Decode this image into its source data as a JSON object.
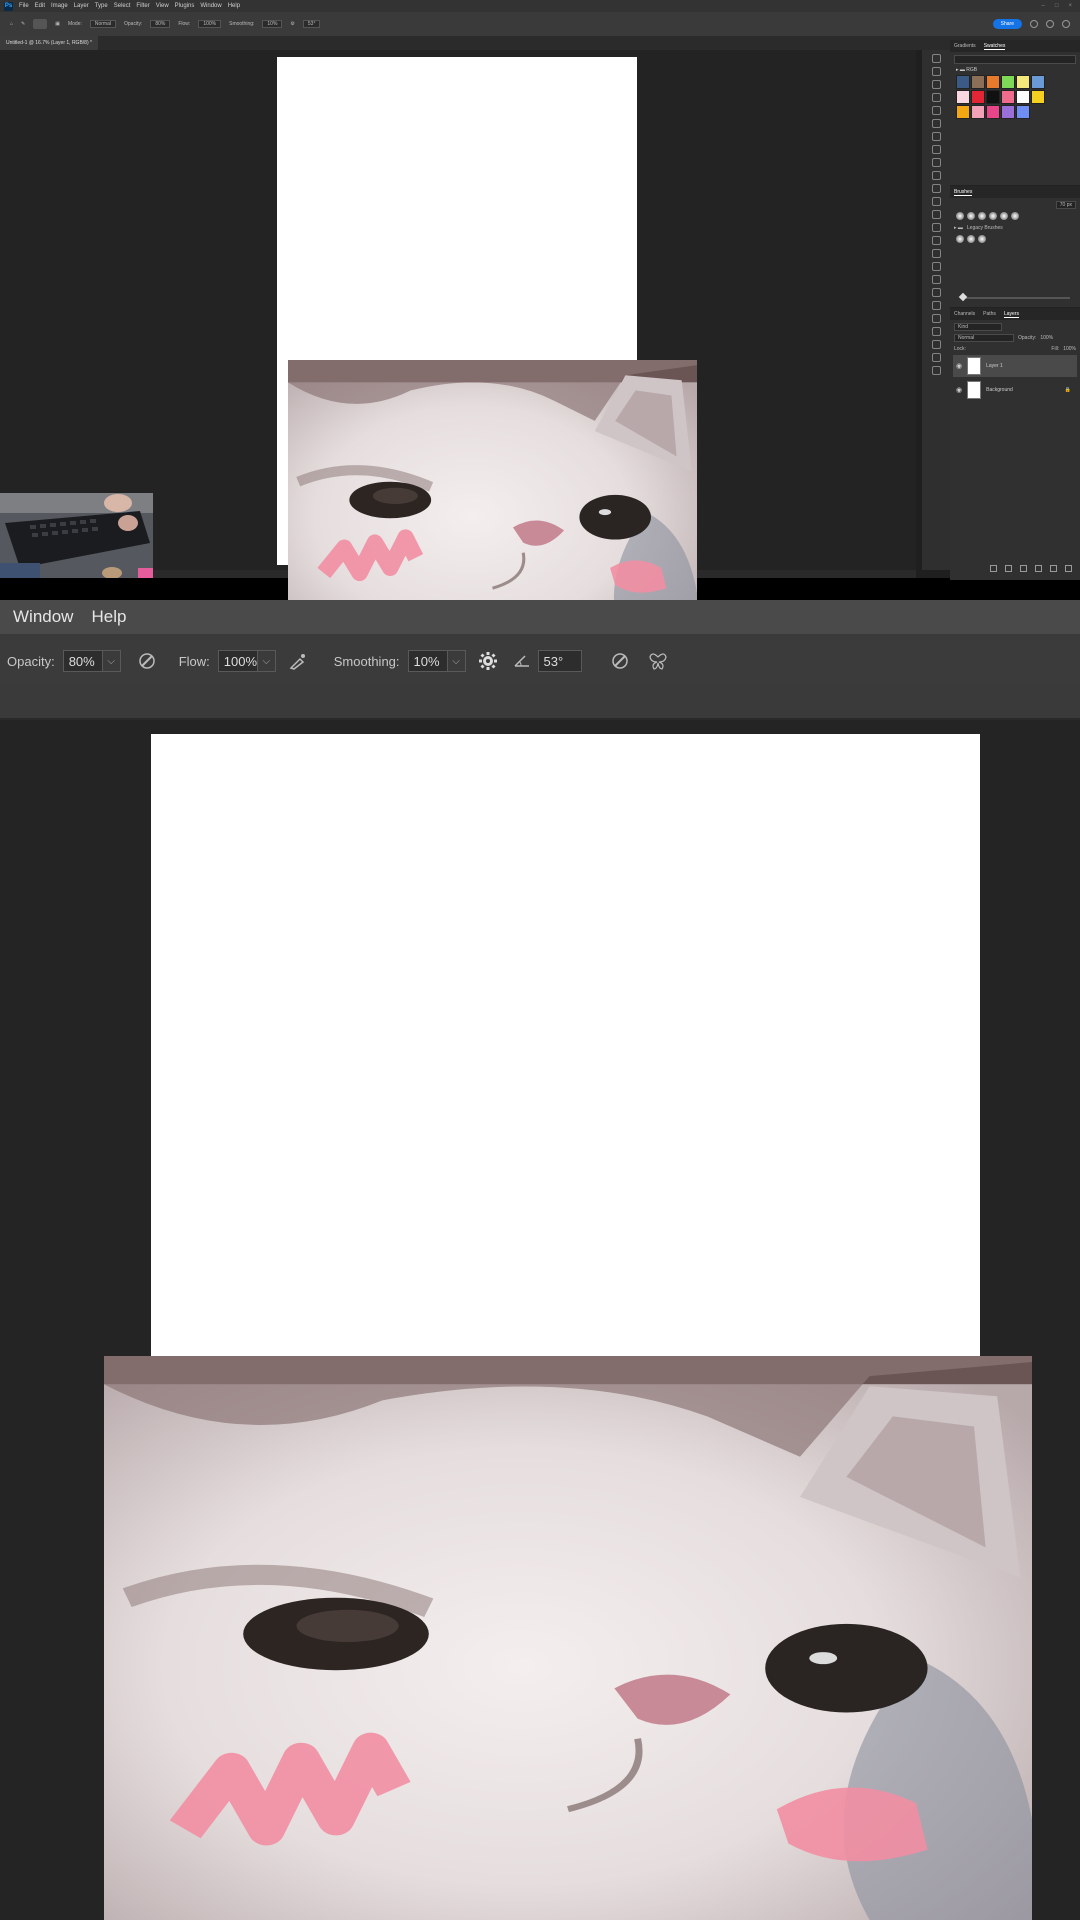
{
  "app": {
    "logo": "Ps",
    "document_tab": "Untitled-1 @ 16.7% (Layer 1, RGB/8) *"
  },
  "menu": {
    "items": [
      "File",
      "Edit",
      "Image",
      "Layer",
      "Type",
      "Select",
      "Filter",
      "View",
      "Plugins",
      "Window",
      "Help"
    ],
    "zoomed_items": [
      "Window",
      "Help"
    ]
  },
  "options_bar": {
    "mode_label": "Mode:",
    "mode_value": "Normal",
    "opacity_label": "Opacity:",
    "opacity_value": "80%",
    "flow_label": "Flow:",
    "flow_value": "100%",
    "smoothing_label": "Smoothing:",
    "smoothing_value": "10%",
    "angle_value": "53°",
    "share_label": "Share"
  },
  "panels": {
    "tabs_top": [
      "Gradients",
      "Swatches"
    ],
    "swatch_folder": "RGB",
    "swatches": [
      "#3c5a86",
      "#8d6e56",
      "#e87a2c",
      "#7ed957",
      "#f4e97a",
      "#6b9bd6",
      "#f8d7e0",
      "#e32636",
      "#111111",
      "#f06c8c",
      "#ffffff",
      "#f5d020",
      "#f3a712",
      "#f2a1b7",
      "#e8458b",
      "#9a6fd8",
      "#6f8ef5"
    ],
    "brushes_title": "Brushes",
    "brush_size": "70 px",
    "brush_folder": "Legacy Brushes",
    "layers_tabs": [
      "Channels",
      "Paths",
      "Layers"
    ],
    "layers_kind": "Kind",
    "blend_mode": "Normal",
    "opacity_label": "Opacity:",
    "opacity_value": "100%",
    "lock_label": "Lock:",
    "fill_label": "Fill:",
    "fill_value": "100%",
    "layers": [
      {
        "name": "Layer 1",
        "selected": true
      },
      {
        "name": "Background",
        "selected": false
      }
    ]
  },
  "colors": {
    "accent": "#1473e6",
    "canvas": "#ffffff",
    "workspace": "#232323"
  }
}
